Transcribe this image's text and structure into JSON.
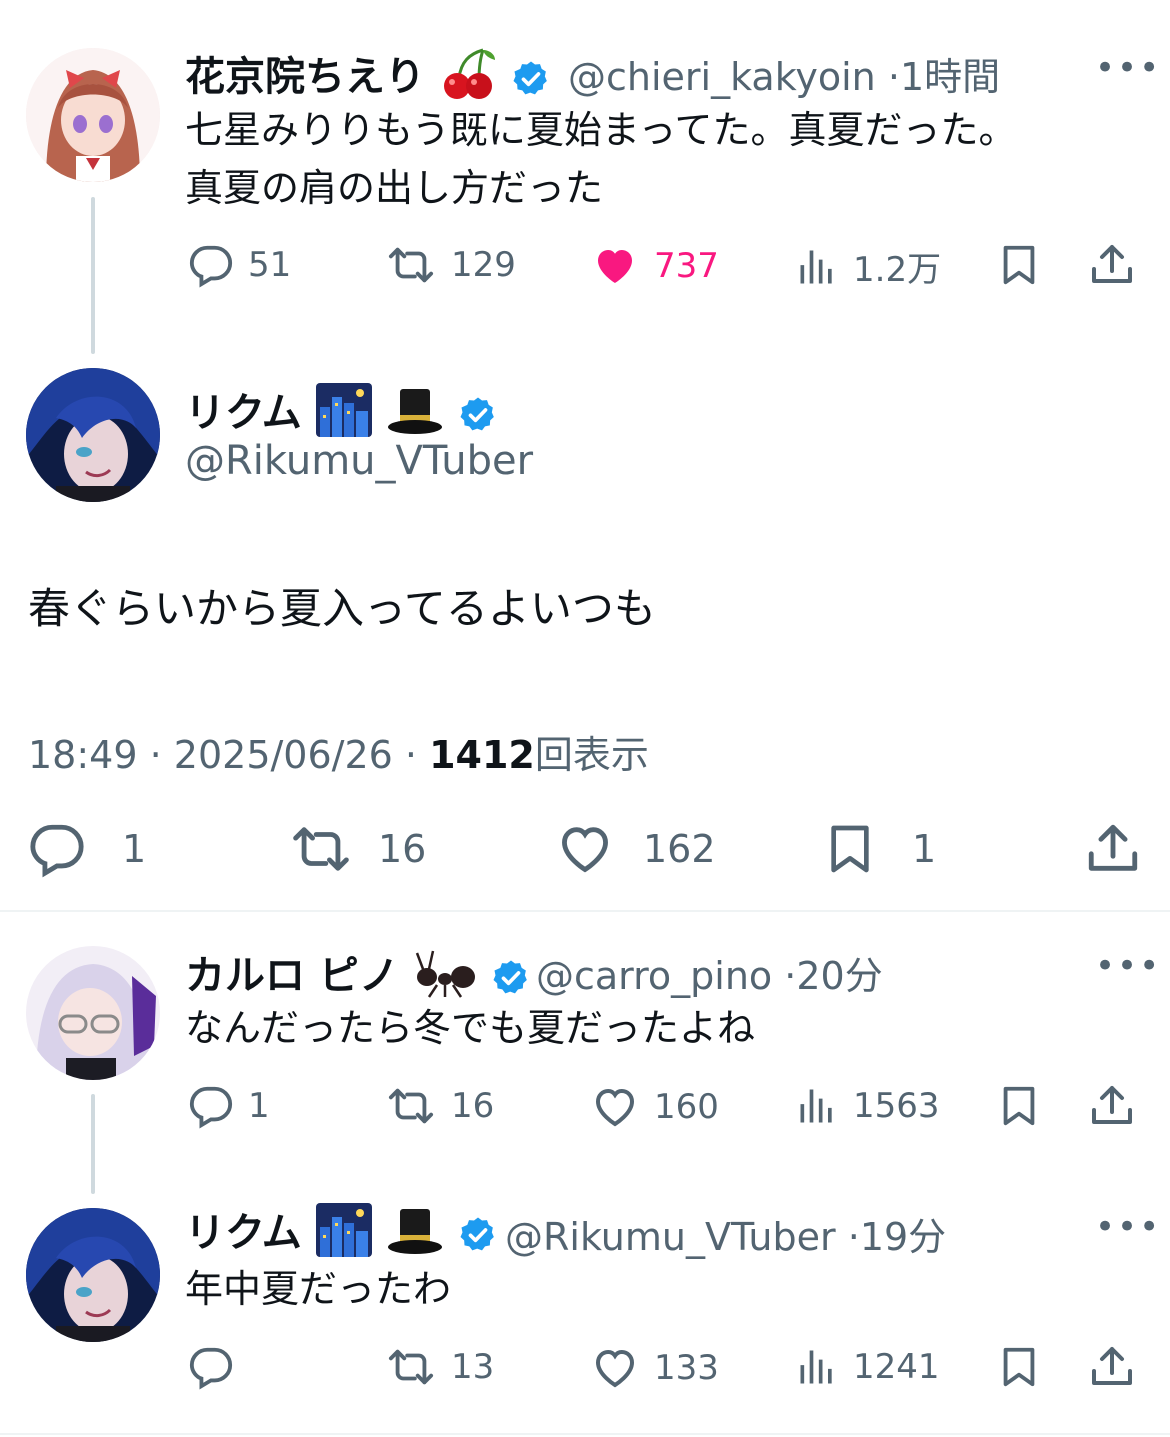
{
  "tweet1": {
    "name": "花京院ちえり",
    "handle": "@chieri_kakyoin",
    "time": "1時間",
    "line1": "七星みりりもう既に夏始まってた。真夏だった。",
    "line2": "真夏の肩の出し方だった",
    "replies": "51",
    "retweets": "129",
    "likes": "737",
    "views": "1.2万",
    "like_color": "#f91880"
  },
  "main": {
    "name": "リクム",
    "handle": "@Rikumu_VTuber",
    "text": "春ぐらいから夏入ってるよいつも",
    "time": "18:49",
    "date": "2025/06/26",
    "views_count": "1412",
    "views_label": "回表示",
    "replies": "1",
    "retweets": "16",
    "likes": "162",
    "bookmarks": "1"
  },
  "reply1": {
    "name": "カルロ ピノ",
    "handle": "@carro_pino",
    "time": "20分",
    "text": "なんだったら冬でも夏だったよね",
    "replies": "1",
    "retweets": "16",
    "likes": "160",
    "views": "1563"
  },
  "reply2": {
    "name": "リクム",
    "handle": "@Rikumu_VTuber",
    "time": "19分",
    "text": "年中夏だったわ",
    "retweets": "13",
    "likes": "133",
    "views": "1241"
  },
  "icons": [
    "reply-icon",
    "retweet-icon",
    "like-icon",
    "views-icon",
    "bookmark-icon",
    "share-icon",
    "verified-icon",
    "more-icon",
    "cherry-emoji",
    "night-city-emoji",
    "top-hat-emoji",
    "ant-emoji"
  ],
  "colors": {
    "verified": "#1d9bf0",
    "text": "#0f1419",
    "secondary": "#536471",
    "like_active": "#f91880"
  }
}
